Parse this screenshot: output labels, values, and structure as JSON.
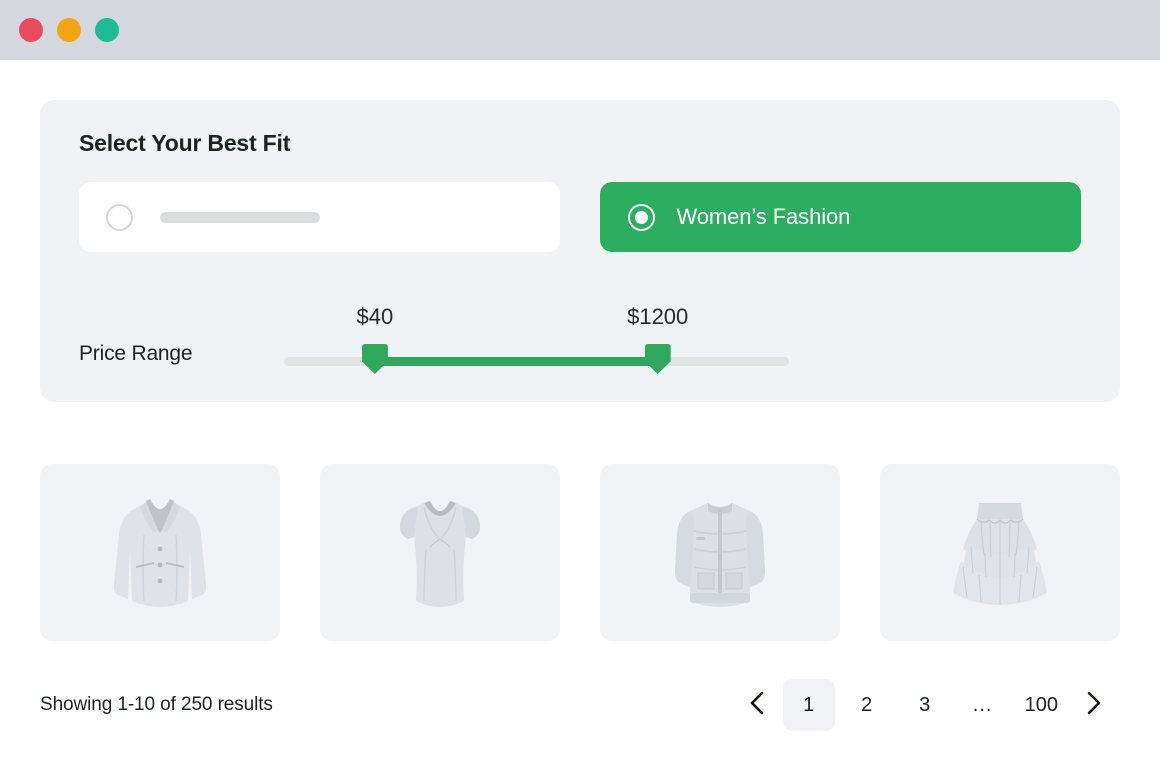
{
  "window": {
    "controls": [
      {
        "name": "close",
        "color": "#e84a5f"
      },
      {
        "name": "minimize",
        "color": "#f5a30f"
      },
      {
        "name": "maximize",
        "color": "#1dbd94"
      }
    ]
  },
  "filter_panel": {
    "title": "Select Your Best Fit",
    "options": [
      {
        "label": "",
        "selected": false,
        "placeholder_skeleton": true
      },
      {
        "label": "Women’s Fashion",
        "selected": true,
        "placeholder_skeleton": false
      }
    ],
    "price_range": {
      "label": "Price Range",
      "min_value": "$40",
      "max_value": "$1200",
      "min_percent": 18,
      "max_percent": 74,
      "track_color": "#e1e2e2",
      "fill_color": "#2fa85d"
    },
    "accent_color": "#2bae5f",
    "panel_color": "#f1f2f6"
  },
  "products": [
    {
      "name": "blazer",
      "icon": "blazer-illustration"
    },
    {
      "name": "blouse",
      "icon": "blouse-illustration"
    },
    {
      "name": "puffer-jacket",
      "icon": "puffer-jacket-illustration"
    },
    {
      "name": "ruffle-skirt",
      "icon": "ruffle-skirt-illustration"
    }
  ],
  "footer": {
    "results_text": "Showing 1-10 of 250 results",
    "pagination": {
      "prev_icon": "chevron-left-icon",
      "next_icon": "chevron-right-icon",
      "pages": [
        {
          "label": "1",
          "active": true,
          "ellipsis": false
        },
        {
          "label": "2",
          "active": false,
          "ellipsis": false
        },
        {
          "label": "3",
          "active": false,
          "ellipsis": false
        },
        {
          "label": "...",
          "active": false,
          "ellipsis": true
        },
        {
          "label": "100",
          "active": false,
          "ellipsis": false
        }
      ]
    }
  }
}
